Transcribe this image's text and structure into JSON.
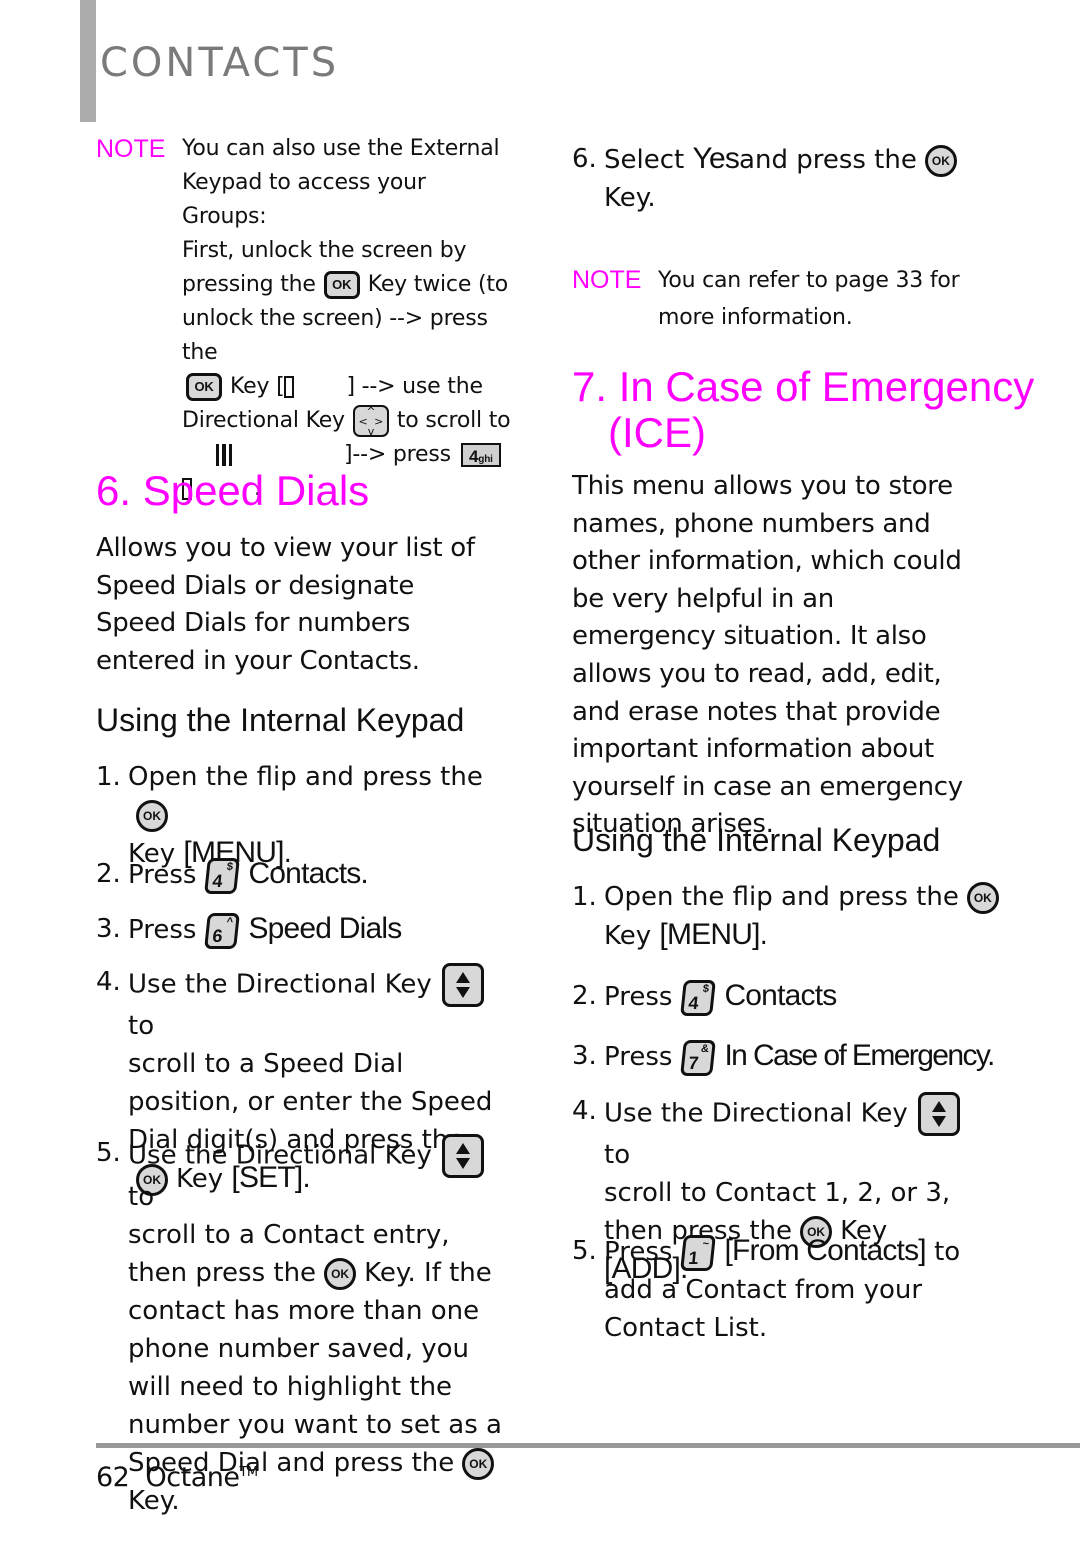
{
  "header": {
    "section": "CONTACTS"
  },
  "left": {
    "note": {
      "label": "NOTE",
      "line1": "You can also use the External",
      "line2": "Keypad to access your Groups:",
      "line3": "First, unlock the screen by",
      "line4a": "pressing the",
      "line4b": "Key twice (to",
      "line5": "unlock the screen) --> press the",
      "line6a": "Key [",
      "line6b": "] --> use the",
      "line7a": "Directional Key",
      "line7b": "to scroll to",
      "line8": "]--> press",
      "line9": "."
    },
    "speed_dials": {
      "title": "6. Speed Dials",
      "description": "Allows you to view your list of Speed Dials or designate Speed Dials for numbers entered in your Contacts.",
      "subtitle": "Using the Internal Keypad",
      "steps": [
        {
          "num": "1.",
          "a": "Open the flip and press the",
          "b": "Key",
          "label": "[MENU]",
          "c": "."
        },
        {
          "num": "2.",
          "a": "Press",
          "key": "4",
          "key_sup": "$",
          "label": "Contacts."
        },
        {
          "num": "3.",
          "a": "Press",
          "key": "6",
          "key_sup": "^",
          "label": "Speed Dials"
        },
        {
          "num": "4.",
          "a": "Use the Directional Key",
          "b": "to",
          "c": "scroll to a Speed Dial position, or enter the Speed Dial digit(s) and press the",
          "d": "Key",
          "label": "[SET]."
        },
        {
          "num": "5.",
          "a": "Use the Directional Key",
          "b": "to",
          "c": "scroll to a Contact entry, then press the",
          "d": "Key. If the contact has more than one phone number saved, you will need to highlight the number you want to set as a Speed Dial and press the",
          "e": "Key."
        }
      ]
    }
  },
  "right": {
    "step6": {
      "num": "6.",
      "a": "Select",
      "label": "Yes",
      "b": "and press the",
      "c": "Key."
    },
    "note": {
      "label": "NOTE",
      "line1": "You can refer to page 33 for",
      "line2": "more information."
    },
    "ice": {
      "title_line1": "7. In Case of Emergency",
      "title_line2": "(ICE)",
      "description": "This menu allows you to store names, phone numbers and other information, which could be very helpful in an emergency situation. It also allows you to read, add, edit, and erase notes that provide important information about yourself in case an emergency situation arises.",
      "subtitle": "Using the Internal Keypad",
      "steps": [
        {
          "num": "1.",
          "a": "Open the flip and press the",
          "b": "Key",
          "label": "[MENU]",
          "c": "."
        },
        {
          "num": "2.",
          "a": "Press",
          "key": "4",
          "key_sup": "$",
          "label": "Contacts"
        },
        {
          "num": "3.",
          "a": "Press",
          "key": "7",
          "key_sup": "&",
          "label": "In Case of Emergency."
        },
        {
          "num": "4.",
          "a": "Use the Directional Key",
          "b": "to",
          "c": "scroll to Contact 1, 2, or 3, then press the",
          "d": "Key",
          "label": "[ADD]."
        },
        {
          "num": "5.",
          "a": "Press",
          "key": "1",
          "key_sup": "~",
          "label": "[From Contacts]",
          "b": "to add a Contact from your Contact List."
        }
      ]
    }
  },
  "keys": {
    "ok": "OK",
    "four_ghi_num": "4",
    "four_ghi_letters": "ghi"
  },
  "footer": {
    "page": "62",
    "product": "Octane",
    "tm": "TM"
  }
}
